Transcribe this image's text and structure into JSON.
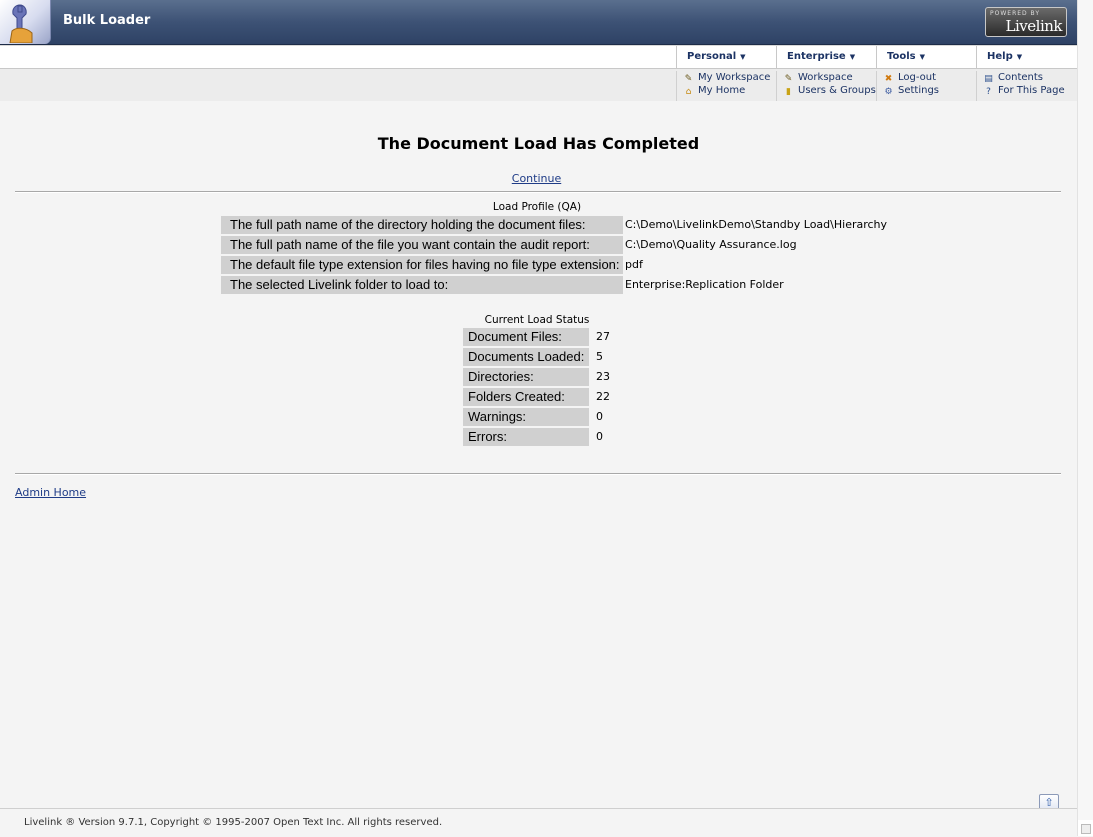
{
  "header": {
    "title": "Bulk Loader",
    "powered_by": "POWERED BY",
    "brand": "Livelink",
    "accent": "#3d5275"
  },
  "menus": [
    {
      "label": "Personal",
      "items": [
        {
          "label": "My Workspace",
          "icon": "workspace-icon"
        },
        {
          "label": "My Home",
          "icon": "home-icon"
        }
      ]
    },
    {
      "label": "Enterprise",
      "items": [
        {
          "label": "Workspace",
          "icon": "workspace-icon"
        },
        {
          "label": "Users & Groups",
          "icon": "users-icon"
        }
      ]
    },
    {
      "label": "Tools",
      "items": [
        {
          "label": "Log-out",
          "icon": "logout-icon"
        },
        {
          "label": "Settings",
          "icon": "settings-icon"
        }
      ]
    },
    {
      "label": "Help",
      "items": [
        {
          "label": "Contents",
          "icon": "contents-icon"
        },
        {
          "label": "For This Page",
          "icon": "help-page-icon"
        }
      ]
    }
  ],
  "main": {
    "title": "The Document Load Has Completed",
    "continue_label": "Continue",
    "profile_caption": "Load Profile (QA)",
    "profile": [
      {
        "label": "The full path name of the directory holding the document files:",
        "value": "C:\\Demo\\LivelinkDemo\\Standby Load\\Hierarchy"
      },
      {
        "label": "The full path name of the file you want contain the audit report:",
        "value": "C:\\Demo\\Quality Assurance.log"
      },
      {
        "label": "The default file type extension for files having no file type extension:",
        "value": "pdf"
      },
      {
        "label": "The selected Livelink folder to load to:",
        "value": "Enterprise:Replication Folder"
      }
    ],
    "status_caption": "Current Load Status",
    "status": [
      {
        "label": "Document Files:",
        "value": "27"
      },
      {
        "label": "Documents Loaded:",
        "value": "5"
      },
      {
        "label": "Directories:",
        "value": "23"
      },
      {
        "label": "Folders Created:",
        "value": "22"
      },
      {
        "label": "Warnings:",
        "value": "0"
      },
      {
        "label": "Errors:",
        "value": "0"
      }
    ],
    "admin_home_label": "Admin Home"
  },
  "footer": {
    "text": "Livelink ® Version 9.7.1, Copyright © 1995-2007 Open Text Inc. All rights reserved."
  }
}
